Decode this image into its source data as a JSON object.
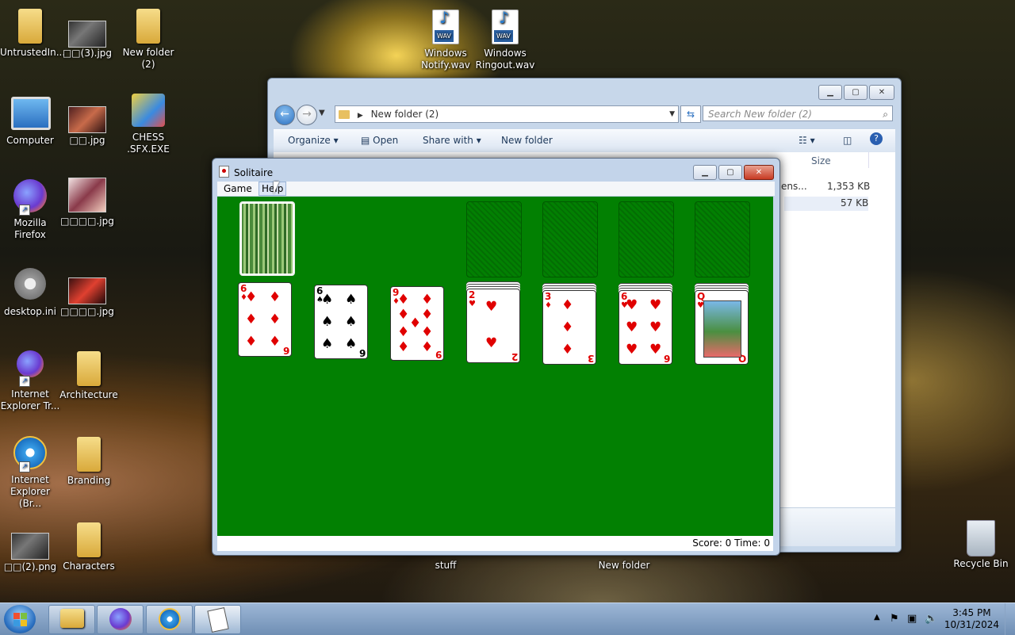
{
  "desktop": {
    "icons": [
      {
        "label": "UntrustedIn...",
        "icon": "folder-user-icon"
      },
      {
        "label": "□□(3).jpg",
        "icon": "image-icon"
      },
      {
        "label": "New folder\n(2)",
        "icon": "folder-icon"
      },
      {
        "label": "Computer",
        "icon": "computer-icon"
      },
      {
        "label": "□□.jpg",
        "icon": "image-icon"
      },
      {
        "label": "CHESS\n.SFX.EXE",
        "icon": "exe-icon"
      },
      {
        "label": "Mozilla\nFirefox",
        "icon": "firefox-icon"
      },
      {
        "label": "□□□□.jpg",
        "icon": "image-icon"
      },
      {
        "label": "desktop.ini",
        "icon": "gear-icon"
      },
      {
        "label": "□□□□.jpg",
        "icon": "image-icon"
      },
      {
        "label": "Internet\nExplorer Tr...",
        "icon": "firefox-icon"
      },
      {
        "label": "Architecture",
        "icon": "folder-icon"
      },
      {
        "label": "Internet\nExplorer (Br...",
        "icon": "ie-icon"
      },
      {
        "label": "Branding",
        "icon": "folder-icon"
      },
      {
        "label": "□□(2).png",
        "icon": "image-icon"
      },
      {
        "label": "Characters",
        "icon": "folder-icon"
      },
      {
        "label": "Windows\nNotify.wav",
        "icon": "wav-icon"
      },
      {
        "label": "Windows\nRingout.wav",
        "icon": "wav-icon"
      },
      {
        "label": "stuff",
        "icon": "folder-icon"
      },
      {
        "label": "New folder",
        "icon": "folder-icon"
      },
      {
        "label": "Recycle Bin",
        "icon": "recycle-bin-icon"
      }
    ]
  },
  "explorer": {
    "address": "New folder (2)",
    "search_placeholder": "Search New folder (2)",
    "toolbar": {
      "organize": "Organize",
      "open": "Open",
      "share_with": "Share with",
      "new_folder": "New folder"
    },
    "columns": {
      "size": "Size"
    },
    "rows": [
      {
        "name_fragment": "ens...",
        "size": "1,353 KB"
      },
      {
        "name_fragment": "",
        "size": "57 KB"
      }
    ]
  },
  "solitaire": {
    "title": "Solitaire",
    "menu": {
      "game": "Game",
      "help": "Help"
    },
    "status": "Score: 0 Time: 0",
    "tableau": [
      {
        "rank": "6",
        "suit": "♦",
        "color": "red"
      },
      {
        "rank": "6",
        "suit": "♠",
        "color": "black"
      },
      {
        "rank": "9",
        "suit": "♦",
        "color": "red"
      },
      {
        "rank": "2",
        "suit": "♥",
        "color": "red"
      },
      {
        "rank": "3",
        "suit": "♦",
        "color": "red"
      },
      {
        "rank": "6",
        "suit": "♥",
        "color": "red"
      },
      {
        "rank": "Q",
        "suit": "♥",
        "color": "red"
      }
    ]
  },
  "taskbar": {
    "clock_time": "3:45 PM",
    "clock_date": "10/31/2024"
  },
  "colors": {
    "felt": "#028002",
    "card_red": "#e00000"
  }
}
